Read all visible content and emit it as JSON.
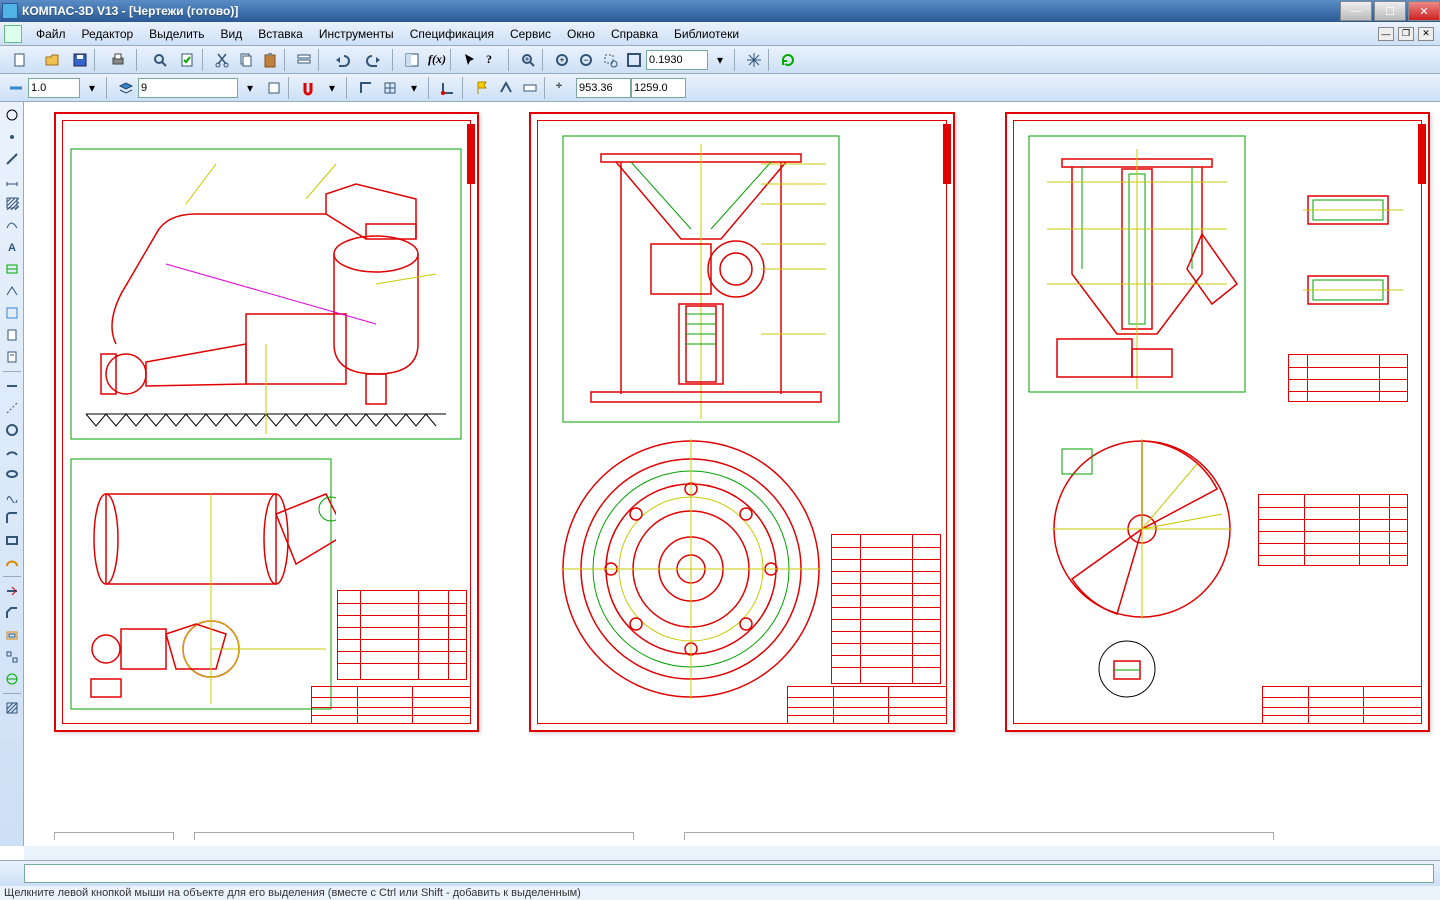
{
  "title": "КОМПАС-3D V13 - [Чертежи (готово)]",
  "menu": [
    "Файл",
    "Редактор",
    "Выделить",
    "Вид",
    "Вставка",
    "Инструменты",
    "Спецификация",
    "Сервис",
    "Окно",
    "Справка",
    "Библиотеки"
  ],
  "toolbar1": {
    "zoom": "0.1930"
  },
  "toolbar2": {
    "line_width": "1.0",
    "layer": "9",
    "coord_x": "953.36",
    "coord_y": "1259.0"
  },
  "status": "Щелкните левой кнопкой мыши на объекте для его выделения (вместе с Ctrl или Shift - добавить к выделенным)"
}
